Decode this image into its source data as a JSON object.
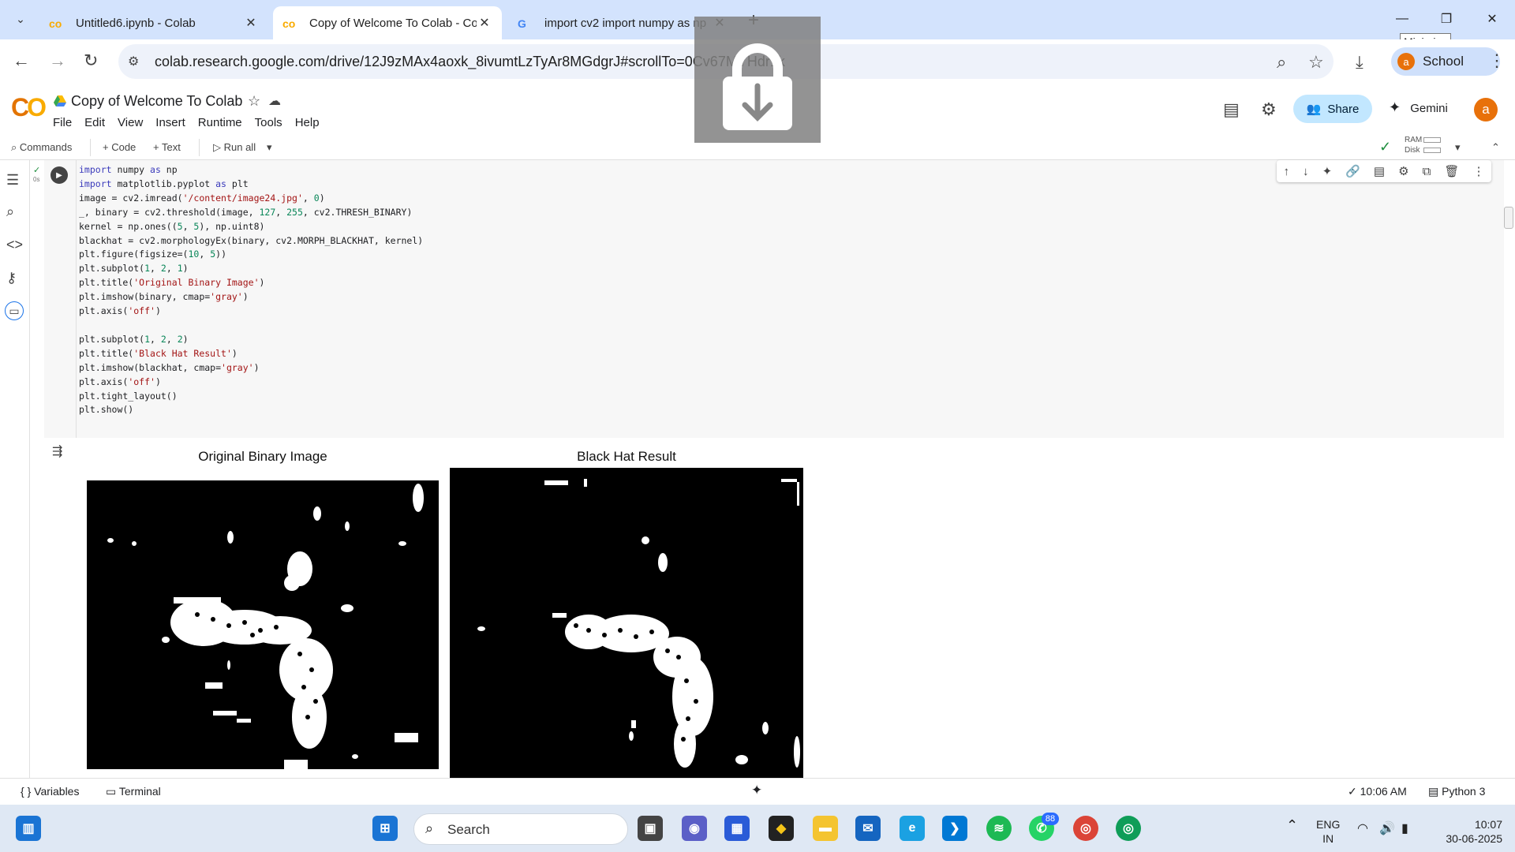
{
  "browser": {
    "tabs": [
      {
        "label": "Untitled6.ipynb - Colab",
        "active": false
      },
      {
        "label": "Copy of Welcome To Colab - Co",
        "active": true
      },
      {
        "label": "import cv2 import numpy as np",
        "active": false
      }
    ],
    "url": "colab.research.google.com/drive/12J9zMAx4aoxk_8ivumtLzTyAr8MGdgrJ#scrollTo=0Cv67MYHdr1k",
    "profile_label": "School",
    "profile_initial": "a",
    "tooltip": "Minimize"
  },
  "colab": {
    "logo": "CO",
    "title": "Copy of Welcome To Colab",
    "menu": [
      "File",
      "Edit",
      "View",
      "Insert",
      "Runtime",
      "Tools",
      "Help"
    ],
    "share_label": "Share",
    "gemini_label": "Gemini",
    "user_initial": "a",
    "commands_label": "Commands",
    "add_code_label": "+ Code",
    "add_text_label": "+ Text",
    "run_all_label": "Run all",
    "ram_label": "RAM",
    "disk_label": "Disk",
    "exec_time": "0s"
  },
  "cell": {
    "code_lines": [
      "import numpy as np",
      "import matplotlib.pyplot as plt",
      "image = cv2.imread('/content/image24.jpg', 0)",
      "_, binary = cv2.threshold(image, 127, 255, cv2.THRESH_BINARY)",
      "kernel = np.ones((5, 5), np.uint8)",
      "blackhat = cv2.morphologyEx(binary, cv2.MORPH_BLACKHAT, kernel)",
      "plt.figure(figsize=(10, 5))",
      "plt.subplot(1, 2, 1)",
      "plt.title('Original Binary Image')",
      "plt.imshow(binary, cmap='gray')",
      "plt.axis('off')",
      "",
      "plt.subplot(1, 2, 2)",
      "plt.title('Black Hat Result')",
      "plt.imshow(blackhat, cmap='gray')",
      "plt.axis('off')",
      "plt.tight_layout()",
      "plt.show()"
    ]
  },
  "output": {
    "plot1_title": "Original Binary Image",
    "plot2_title": "Black Hat Result"
  },
  "statusbar": {
    "variables": "Variables",
    "terminal": "Terminal",
    "time": "10:06 AM",
    "runtime": "Python 3"
  },
  "taskbar": {
    "search_label": "Search",
    "lang": "ENG",
    "region": "IN",
    "clock_time": "10:07",
    "clock_date": "30-06-2025",
    "whatsapp_badge": "88"
  },
  "colors": {
    "tabstrip": "#d3e3fd",
    "share_bg": "#c2e7ff",
    "accent_orange": "#e8710a"
  }
}
